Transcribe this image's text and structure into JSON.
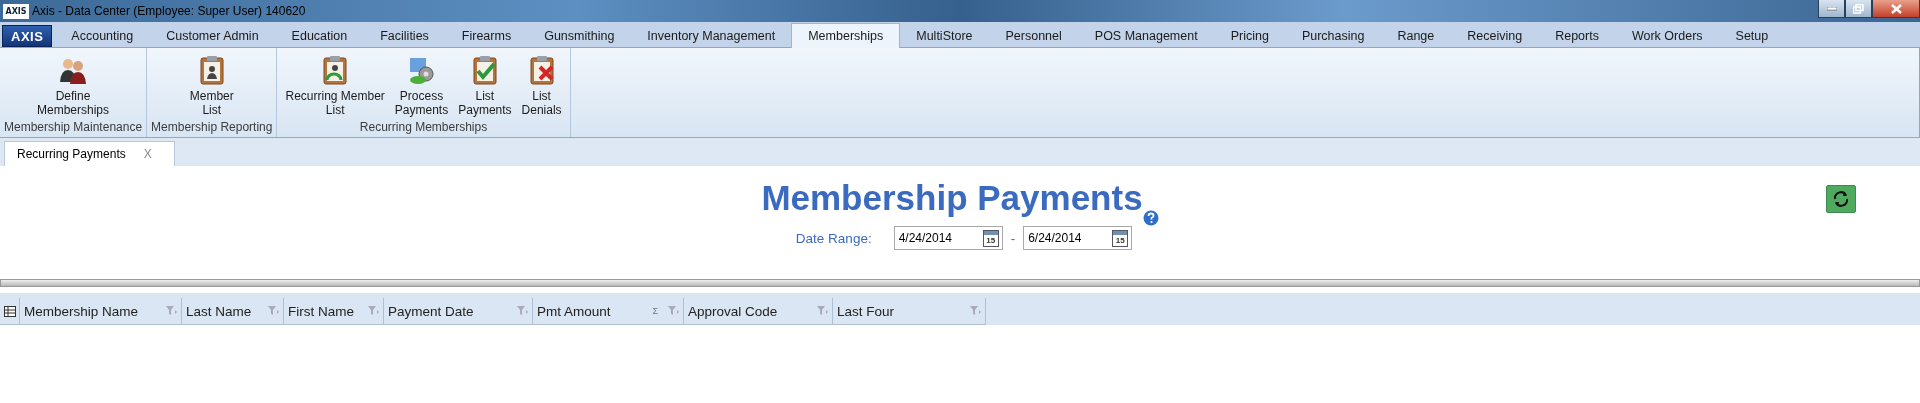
{
  "window": {
    "title": "Axis - Data Center  (Employee: Super User) 140620",
    "app_icon_text": "AXIS"
  },
  "menu_tabs": [
    {
      "label": "AXIS",
      "kind": "logo",
      "selected": false
    },
    {
      "label": "Accounting",
      "kind": "tab",
      "selected": false
    },
    {
      "label": "Customer Admin",
      "kind": "tab",
      "selected": false
    },
    {
      "label": "Education",
      "kind": "tab",
      "selected": false
    },
    {
      "label": "Facilities",
      "kind": "tab",
      "selected": false
    },
    {
      "label": "Firearms",
      "kind": "tab",
      "selected": false
    },
    {
      "label": "Gunsmithing",
      "kind": "tab",
      "selected": false
    },
    {
      "label": "Inventory Management",
      "kind": "tab",
      "selected": false
    },
    {
      "label": "Memberships",
      "kind": "tab",
      "selected": true
    },
    {
      "label": "MultiStore",
      "kind": "tab",
      "selected": false
    },
    {
      "label": "Personnel",
      "kind": "tab",
      "selected": false
    },
    {
      "label": "POS Management",
      "kind": "tab",
      "selected": false
    },
    {
      "label": "Pricing",
      "kind": "tab",
      "selected": false
    },
    {
      "label": "Purchasing",
      "kind": "tab",
      "selected": false
    },
    {
      "label": "Range",
      "kind": "tab",
      "selected": false
    },
    {
      "label": "Receiving",
      "kind": "tab",
      "selected": false
    },
    {
      "label": "Reports",
      "kind": "tab",
      "selected": false
    },
    {
      "label": "Work Orders",
      "kind": "tab",
      "selected": false
    },
    {
      "label": "Setup",
      "kind": "tab",
      "selected": false
    }
  ],
  "ribbon_groups": [
    {
      "label": "Membership Maintenance",
      "buttons": [
        {
          "label": "Define\nMemberships",
          "kind": "people"
        }
      ]
    },
    {
      "label": "Membership Reporting",
      "buttons": [
        {
          "label": "Member\nList",
          "kind": "clipboard"
        }
      ]
    },
    {
      "label": "Recurring Memberships",
      "buttons": [
        {
          "label": "Recurring Member\nList",
          "kind": "recurring"
        },
        {
          "label": "Process\nPayments",
          "kind": "gears"
        },
        {
          "label": "List\nPayments",
          "kind": "check"
        },
        {
          "label": "List\nDenials",
          "kind": "deny"
        }
      ]
    }
  ],
  "document_tabs": [
    {
      "label": "Recurring Payments",
      "close": "X",
      "selected": true
    }
  ],
  "page": {
    "title": "Membership Payments",
    "date_range_label": "Date Range:",
    "separator": "-",
    "date_from": {
      "value": "4/24/2014",
      "calendar_day": "15"
    },
    "date_to": {
      "value": "6/24/2014",
      "calendar_day": "15"
    }
  },
  "table": {
    "columns": [
      {
        "label": "Membership Name"
      },
      {
        "label": "Last Name"
      },
      {
        "label": "First Name"
      },
      {
        "label": "Payment Date"
      },
      {
        "label": "Pmt Amount",
        "sum_symbol": "Σ"
      },
      {
        "label": "Approval Code"
      },
      {
        "label": "Last Four"
      }
    ]
  }
}
